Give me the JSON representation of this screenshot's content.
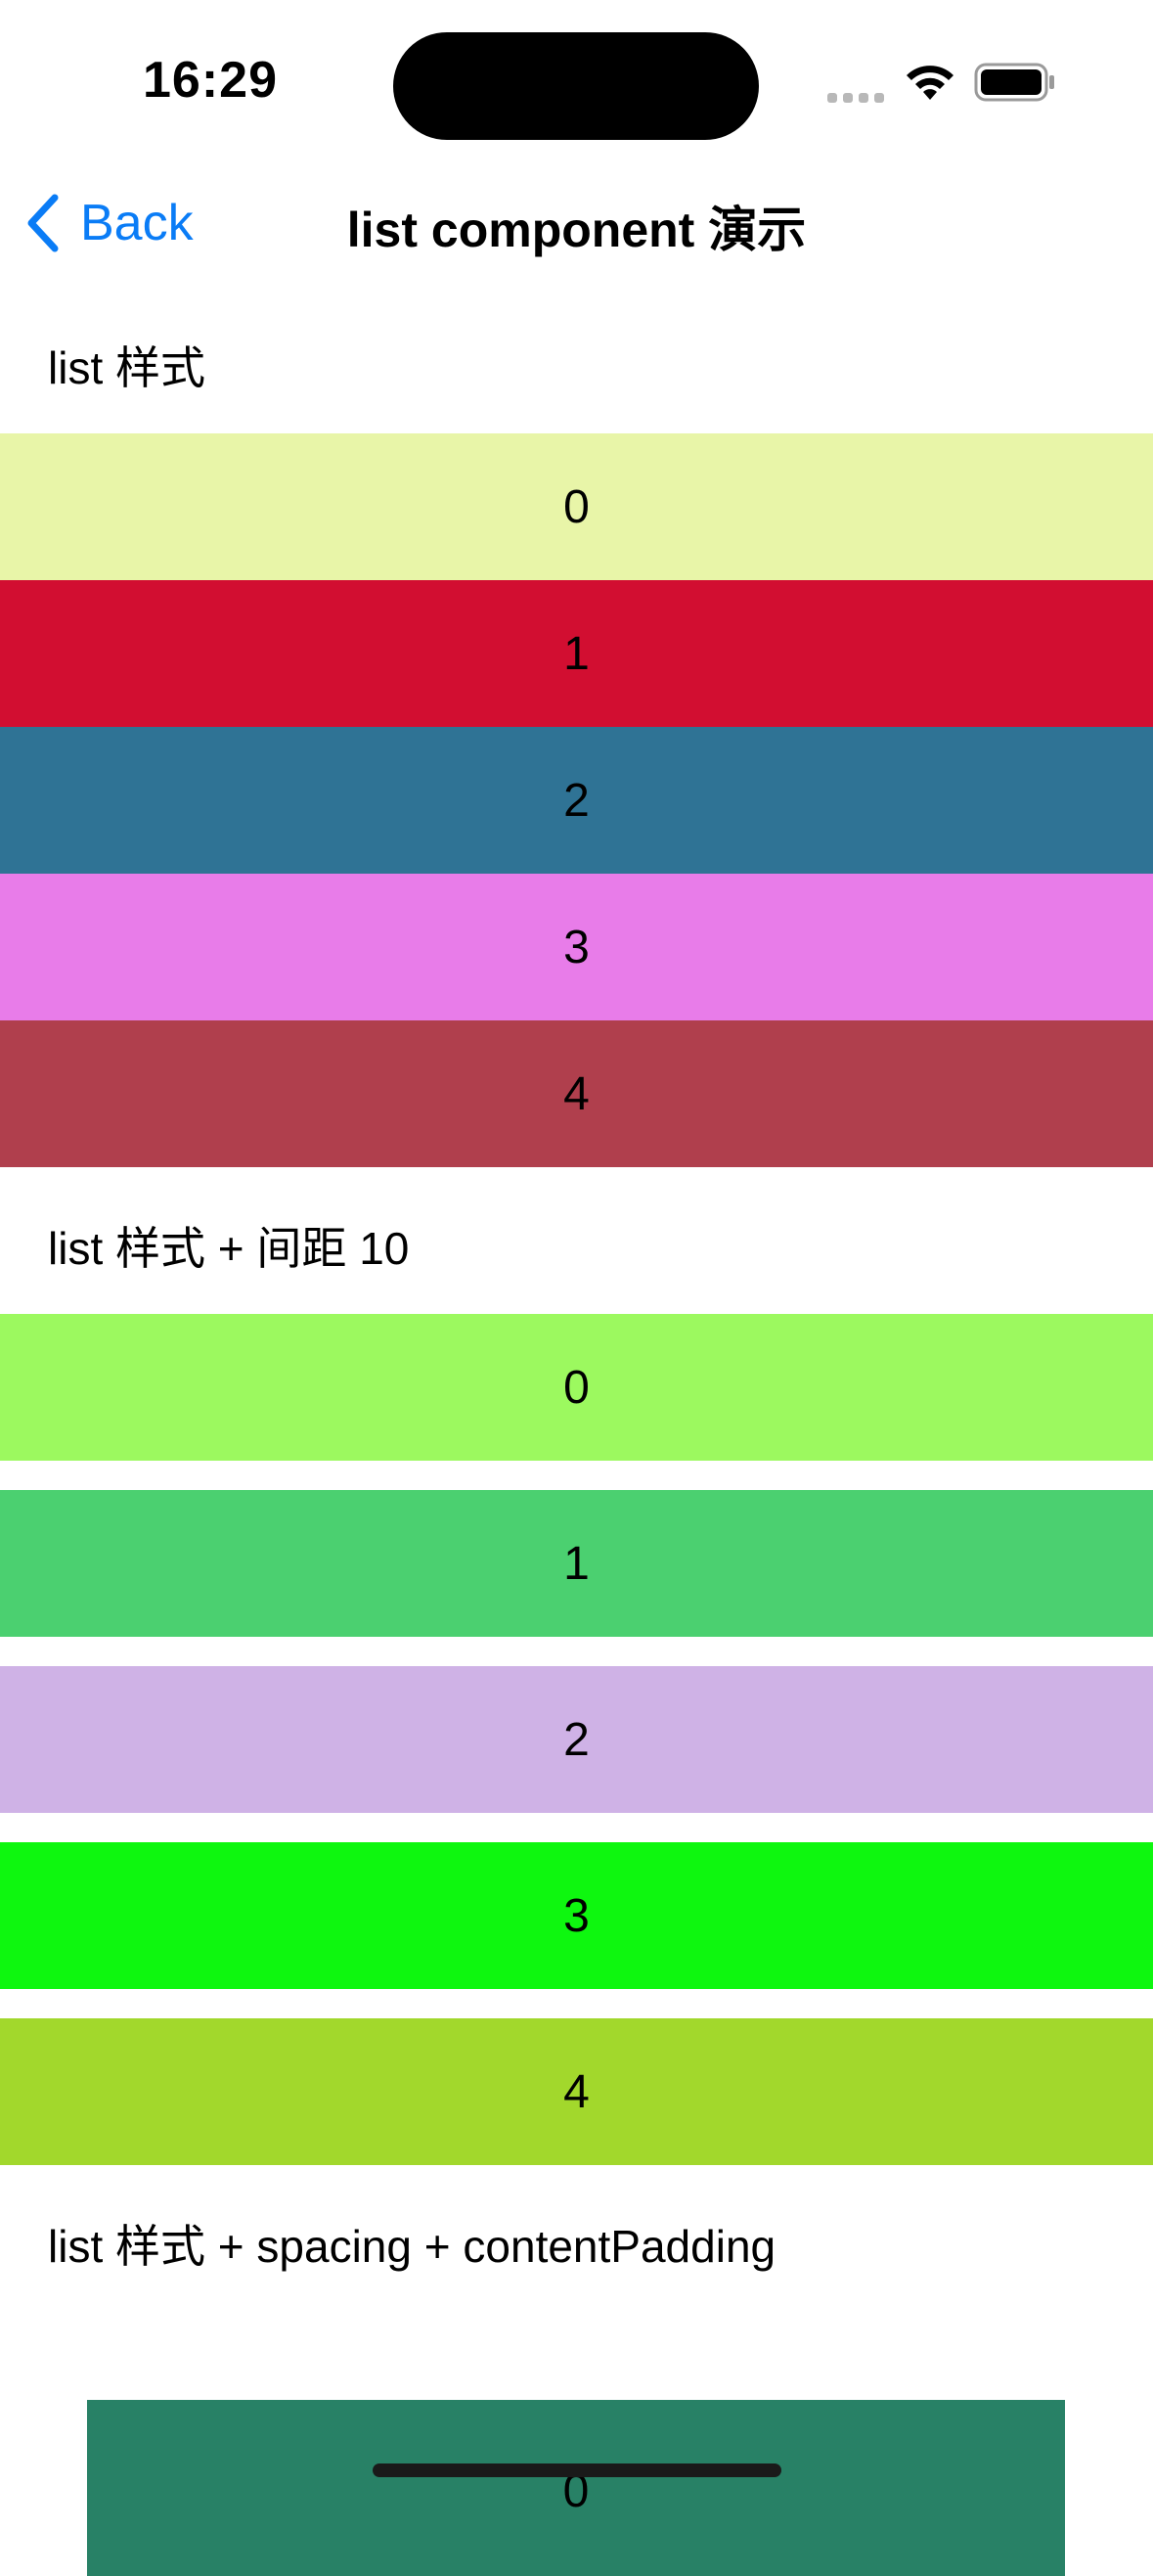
{
  "status_bar": {
    "time": "16:29",
    "icons": [
      "cellular-signal-icon",
      "wifi-icon",
      "battery-icon"
    ]
  },
  "nav": {
    "back_label": "Back",
    "title": "list component 演示",
    "accent": "#0a7cf6"
  },
  "sections": [
    {
      "label": "list 样式",
      "rows": [
        {
          "label": "0",
          "color": "#e8f5a8"
        },
        {
          "label": "1",
          "color": "#d20e31"
        },
        {
          "label": "2",
          "color": "#2f7395"
        },
        {
          "label": "3",
          "color": "#e87ce9"
        },
        {
          "label": "4",
          "color": "#b03f4d"
        }
      ]
    },
    {
      "label": "list 样式 + 间距 10",
      "rows": [
        {
          "label": "0",
          "color": "#9cf95f"
        },
        {
          "label": "1",
          "color": "#4bd070"
        },
        {
          "label": "2",
          "color": "#cfb2e6"
        },
        {
          "label": "3",
          "color": "#0ef70f"
        },
        {
          "label": "4",
          "color": "#a2d82c"
        }
      ]
    },
    {
      "label": "list 样式 + spacing + contentPadding",
      "rows": [
        {
          "label": "0",
          "color": "#288166"
        }
      ]
    }
  ]
}
